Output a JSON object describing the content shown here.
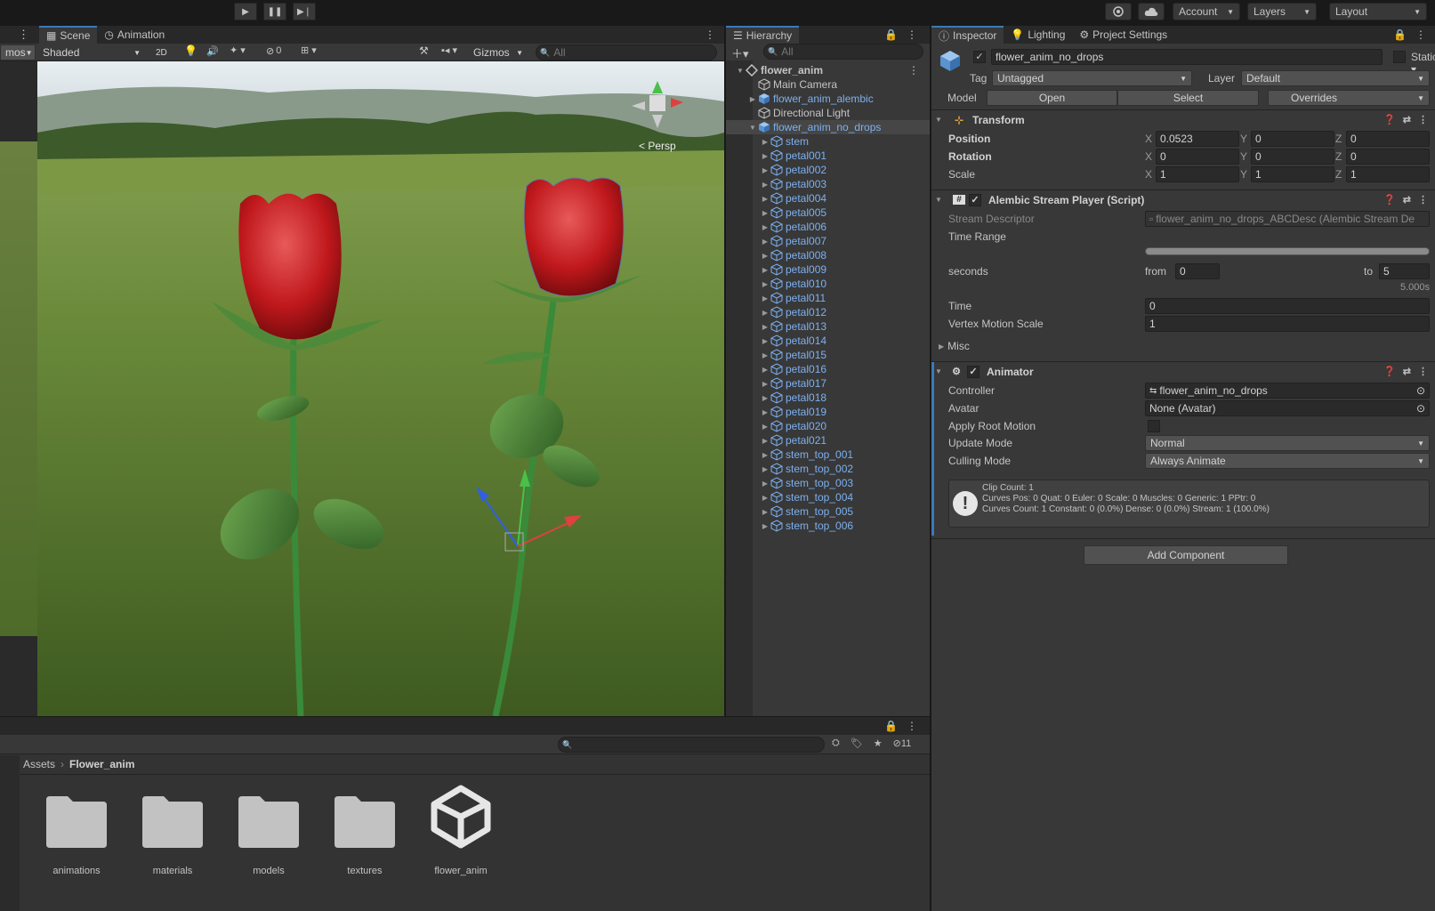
{
  "toolbar": {
    "play_icon": "play-icon",
    "pause_icon": "pause-icon",
    "step_icon": "step-icon",
    "account_label": "Account",
    "layers_label": "Layers",
    "layout_label": "Layout"
  },
  "scene": {
    "tabs": [
      {
        "label": "Scene"
      },
      {
        "label": "Animation"
      }
    ],
    "left_clip_label": "mos",
    "shading_mode": "Shaded",
    "mode_2d": "2D",
    "hidden_count": "0",
    "gizmos_label": "Gizmos",
    "search_placeholder": "All",
    "persp_label": "< Persp"
  },
  "hierarchy": {
    "tab_label": "Hierarchy",
    "search_placeholder": "All",
    "items": [
      {
        "label": "flower_anim",
        "indent": 0,
        "bold": true,
        "blue": false,
        "arrow": "▼",
        "icon": "scene"
      },
      {
        "label": "Main Camera",
        "indent": 1,
        "blue": false,
        "arrow": "",
        "icon": "cube"
      },
      {
        "label": "flower_anim_alembic",
        "indent": 1,
        "blue": true,
        "arrow": "▶",
        "icon": "prefab"
      },
      {
        "label": "Directional Light",
        "indent": 1,
        "blue": false,
        "arrow": "",
        "icon": "cube"
      },
      {
        "label": "flower_anim_no_drops",
        "indent": 1,
        "blue": true,
        "arrow": "▼",
        "icon": "prefab",
        "selected": true
      },
      {
        "label": "stem",
        "indent": 2,
        "blue": true,
        "arrow": "▶",
        "icon": "cube"
      },
      {
        "label": "petal001",
        "indent": 2,
        "blue": true,
        "arrow": "▶",
        "icon": "cube"
      },
      {
        "label": "petal002",
        "indent": 2,
        "blue": true,
        "arrow": "▶",
        "icon": "cube"
      },
      {
        "label": "petal003",
        "indent": 2,
        "blue": true,
        "arrow": "▶",
        "icon": "cube"
      },
      {
        "label": "petal004",
        "indent": 2,
        "blue": true,
        "arrow": "▶",
        "icon": "cube"
      },
      {
        "label": "petal005",
        "indent": 2,
        "blue": true,
        "arrow": "▶",
        "icon": "cube"
      },
      {
        "label": "petal006",
        "indent": 2,
        "blue": true,
        "arrow": "▶",
        "icon": "cube"
      },
      {
        "label": "petal007",
        "indent": 2,
        "blue": true,
        "arrow": "▶",
        "icon": "cube"
      },
      {
        "label": "petal008",
        "indent": 2,
        "blue": true,
        "arrow": "▶",
        "icon": "cube"
      },
      {
        "label": "petal009",
        "indent": 2,
        "blue": true,
        "arrow": "▶",
        "icon": "cube"
      },
      {
        "label": "petal010",
        "indent": 2,
        "blue": true,
        "arrow": "▶",
        "icon": "cube"
      },
      {
        "label": "petal011",
        "indent": 2,
        "blue": true,
        "arrow": "▶",
        "icon": "cube"
      },
      {
        "label": "petal012",
        "indent": 2,
        "blue": true,
        "arrow": "▶",
        "icon": "cube"
      },
      {
        "label": "petal013",
        "indent": 2,
        "blue": true,
        "arrow": "▶",
        "icon": "cube"
      },
      {
        "label": "petal014",
        "indent": 2,
        "blue": true,
        "arrow": "▶",
        "icon": "cube"
      },
      {
        "label": "petal015",
        "indent": 2,
        "blue": true,
        "arrow": "▶",
        "icon": "cube"
      },
      {
        "label": "petal016",
        "indent": 2,
        "blue": true,
        "arrow": "▶",
        "icon": "cube"
      },
      {
        "label": "petal017",
        "indent": 2,
        "blue": true,
        "arrow": "▶",
        "icon": "cube"
      },
      {
        "label": "petal018",
        "indent": 2,
        "blue": true,
        "arrow": "▶",
        "icon": "cube"
      },
      {
        "label": "petal019",
        "indent": 2,
        "blue": true,
        "arrow": "▶",
        "icon": "cube"
      },
      {
        "label": "petal020",
        "indent": 2,
        "blue": true,
        "arrow": "▶",
        "icon": "cube"
      },
      {
        "label": "petal021",
        "indent": 2,
        "blue": true,
        "arrow": "▶",
        "icon": "cube"
      },
      {
        "label": "stem_top_001",
        "indent": 2,
        "blue": true,
        "arrow": "▶",
        "icon": "cube"
      },
      {
        "label": "stem_top_002",
        "indent": 2,
        "blue": true,
        "arrow": "▶",
        "icon": "cube"
      },
      {
        "label": "stem_top_003",
        "indent": 2,
        "blue": true,
        "arrow": "▶",
        "icon": "cube"
      },
      {
        "label": "stem_top_004",
        "indent": 2,
        "blue": true,
        "arrow": "▶",
        "icon": "cube"
      },
      {
        "label": "stem_top_005",
        "indent": 2,
        "blue": true,
        "arrow": "▶",
        "icon": "cube"
      },
      {
        "label": "stem_top_006",
        "indent": 2,
        "blue": true,
        "arrow": "▶",
        "icon": "cube"
      }
    ]
  },
  "inspector": {
    "tabs": [
      {
        "label": "Inspector"
      },
      {
        "label": "Lighting"
      },
      {
        "label": "Project Settings"
      }
    ],
    "object_name": "flower_anim_no_drops",
    "static_label": "Static",
    "tag_label": "Tag",
    "tag_value": "Untagged",
    "layer_label": "Layer",
    "layer_value": "Default",
    "model_label": "Model",
    "open_label": "Open",
    "select_label": "Select",
    "overrides_label": "Overrides",
    "transform": {
      "title": "Transform",
      "position_label": "Position",
      "rotation_label": "Rotation",
      "scale_label": "Scale",
      "axis_x": "X",
      "axis_y": "Y",
      "axis_z": "Z",
      "position": {
        "x": "0.0523",
        "y": "0",
        "z": "0"
      },
      "rotation": {
        "x": "0",
        "y": "0",
        "z": "0"
      },
      "scale": {
        "x": "1",
        "y": "1",
        "z": "1"
      }
    },
    "alembic": {
      "title": "Alembic Stream Player (Script)",
      "stream_descriptor_label": "Stream Descriptor",
      "stream_descriptor_value": "flower_anim_no_drops_ABCDesc (Alembic Stream De",
      "time_range_label": "Time Range",
      "seconds_label": "seconds",
      "from_label": "from",
      "from_value": "0",
      "to_label": "to",
      "to_value": "5",
      "duration_text": "5.000s",
      "time_label": "Time",
      "time_value": "0",
      "vertex_motion_label": "Vertex Motion Scale",
      "vertex_motion_value": "1",
      "misc_label": "Misc"
    },
    "animator": {
      "title": "Animator",
      "controller_label": "Controller",
      "controller_value": "flower_anim_no_drops",
      "avatar_label": "Avatar",
      "avatar_value": "None (Avatar)",
      "apply_root_motion_label": "Apply Root Motion",
      "update_mode_label": "Update Mode",
      "update_mode_value": "Normal",
      "culling_mode_label": "Culling Mode",
      "culling_mode_value": "Always Animate",
      "info_line1": "Clip Count: 1",
      "info_line2": "Curves Pos: 0 Quat: 0 Euler: 0 Scale: 0 Muscles: 0 Generic: 1 PPtr: 0",
      "info_line3": "Curves Count: 1 Constant: 0 (0.0%) Dense: 0 (0.0%) Stream: 1 (100.0%)"
    },
    "add_component_label": "Add Component"
  },
  "project": {
    "hidden_count": "11",
    "breadcrumb_root": "Assets",
    "breadcrumb_current": "Flower_anim",
    "assets": [
      {
        "label": "animations",
        "type": "folder"
      },
      {
        "label": "materials",
        "type": "folder"
      },
      {
        "label": "models",
        "type": "folder"
      },
      {
        "label": "textures",
        "type": "folder"
      },
      {
        "label": "flower_anim",
        "type": "unity"
      }
    ]
  },
  "colors": {
    "accent": "#3a79bb",
    "prefab_blue": "#7cb0f0",
    "panel": "#383838",
    "field": "#2a2a2a"
  }
}
